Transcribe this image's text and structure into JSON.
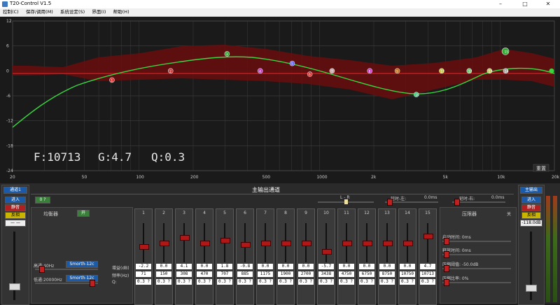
{
  "window": {
    "title": "T20-Control V1.5"
  },
  "menu": [
    "控制(C)",
    "保存/调用(M)",
    "系统设定(S)",
    "界面(I)",
    "帮助(H)"
  ],
  "plot": {
    "readout": {
      "f": "F:10713",
      "g": "G:4.7",
      "q": "Q:0.3"
    },
    "reset_label": "重置",
    "y_ticks": [
      "12",
      "6",
      "0",
      "-6",
      "-12",
      "-18",
      "-24"
    ],
    "x_ticks": [
      "20",
      "50",
      "100",
      "200",
      "500",
      "1000",
      "2k",
      "5k",
      "10k",
      "20k"
    ],
    "colors": {
      "curve": "#39d63f",
      "band": "#7a0f0f",
      "flat": "#d02020"
    }
  },
  "left_strip": {
    "channel_select": "通道1",
    "btn_in": "进入",
    "btn_mute": "静音",
    "btn_invert": "反相",
    "btn_link": "— —"
  },
  "right_strip": {
    "channel_select": "主输出",
    "btn_in": "进入",
    "btn_mute": "静音",
    "btn_invert": "反相",
    "level": "-118.0dB"
  },
  "header": {
    "title": "主输出通道",
    "left_value": "0 ?",
    "lr_label": "L - R",
    "delay_left_label": "延时-左:",
    "delay_left_value": "0.0ms",
    "delay_right_label": "延时-右:",
    "delay_right_value": "0.0ms"
  },
  "eq": {
    "title": "均衡器",
    "toggle": "开",
    "highpass_label": "高通:40Hz",
    "highpass_mode": "Smorth-12c",
    "lowpass_label": "低通:20000Hz",
    "lowpass_mode": "Smorth-12c",
    "row_gain": "增益(dB)",
    "row_freq": "频率(Hz)",
    "row_q": "Q:"
  },
  "bands": [
    {
      "num": "1",
      "gain": "-2.2",
      "freq": "71",
      "q": "0.3 ?"
    },
    {
      "num": "2",
      "gain": "0.0",
      "freq": "150",
      "q": "0.3 ?"
    },
    {
      "num": "3",
      "gain": "4.1",
      "freq": "308",
      "q": "0.3 ?"
    },
    {
      "num": "4",
      "gain": "0.0",
      "freq": "470",
      "q": "0.3 ?"
    },
    {
      "num": "5",
      "gain": "1.8",
      "freq": "707",
      "q": "0.3 ?"
    },
    {
      "num": "6",
      "gain": "-0.8",
      "freq": "885",
      "q": "0.3 ?"
    },
    {
      "num": "7",
      "gain": "0.0",
      "freq": "1175",
      "q": "0.3 ?"
    },
    {
      "num": "8",
      "gain": "0.0",
      "freq": "1900",
      "q": "0.3 ?"
    },
    {
      "num": "9",
      "gain": "0.0",
      "freq": "2700",
      "q": "0.3 ?"
    },
    {
      "num": "10",
      "gain": "-5.7",
      "freq": "3438",
      "q": "0.3 ?"
    },
    {
      "num": "11",
      "gain": "0.0",
      "freq": "4750",
      "q": "0.3 ?"
    },
    {
      "num": "12",
      "gain": "0.0",
      "freq": "6750",
      "q": "0.3 ?"
    },
    {
      "num": "13",
      "gain": "0.0",
      "freq": "8750",
      "q": "0.3 ?"
    },
    {
      "num": "14",
      "gain": "0.0",
      "freq": "10750",
      "q": "0.3 ?"
    },
    {
      "num": "15",
      "gain": "4.7",
      "freq": "10713",
      "q": "0.3 ?"
    }
  ],
  "limiter": {
    "title": "压限器",
    "toggle": "关",
    "attack": "启动时间: 0ms",
    "release": "释放时间: 0ms",
    "threshold": "压缩阈值: -50.0dB",
    "ratio": "压缩比率: 0%"
  }
}
